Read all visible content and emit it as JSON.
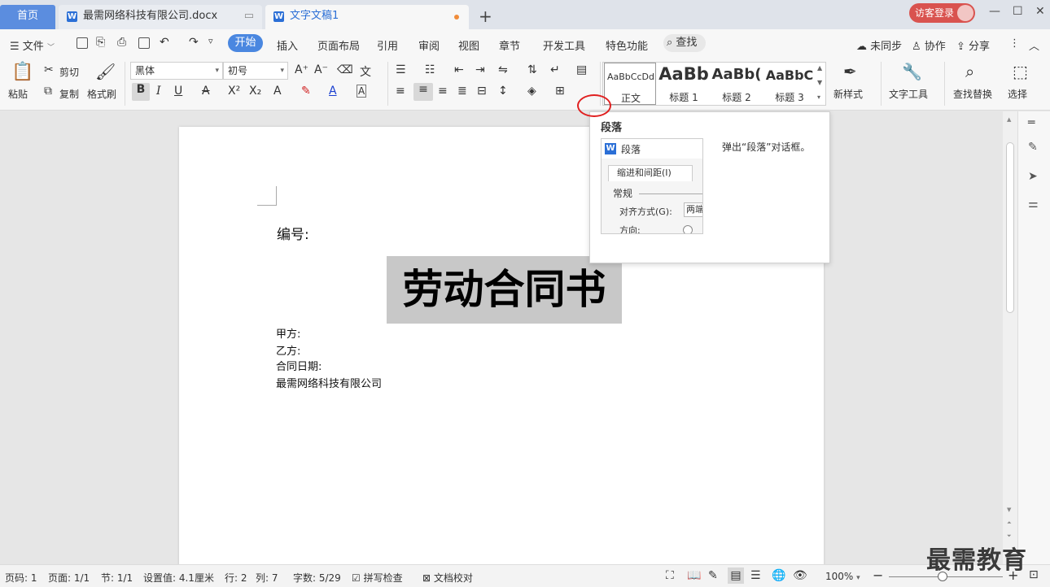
{
  "tabs": {
    "home": "首页",
    "doc1": "最需网络科技有限公司.docx",
    "doc2": "文字文稿1",
    "new_tab": "+"
  },
  "account": {
    "login": "访客登录"
  },
  "window": {
    "minimize": "—",
    "maximize": "☐",
    "close": "✕"
  },
  "menu": {
    "file": "文件",
    "start": "开始",
    "insert": "插入",
    "layout": "页面布局",
    "references": "引用",
    "review": "审阅",
    "view": "视图",
    "chapter": "章节",
    "developer": "开发工具",
    "special": "特色功能",
    "search": "查找",
    "sync": "未同步",
    "collab": "协作",
    "share": "分享"
  },
  "ribbon": {
    "paste": "粘贴",
    "cut": "剪切",
    "copy": "复制",
    "format_painter": "格式刷",
    "font_name": "黑体",
    "font_size": "初号",
    "styles": [
      {
        "preview": "AaBbCcDd",
        "name": "正文"
      },
      {
        "preview": "AaBb",
        "name": "标题 1"
      },
      {
        "preview": "AaBb(",
        "name": "标题 2"
      },
      {
        "preview": "AaBbC",
        "name": "标题 3"
      }
    ],
    "new_style": "新样式",
    "text_tools": "文字工具",
    "find_replace": "查找替换",
    "select": "选择"
  },
  "document": {
    "number_label": "编号:",
    "title": "劳动合同书",
    "party_a": "甲方:",
    "party_b": "乙方:",
    "contract_date": "合同日期:",
    "company": "最需网络科技有限公司"
  },
  "popup": {
    "title": "段落",
    "preview_title": "段落",
    "preview_tab": "缩进和间距(I)",
    "preview_section": "常规",
    "preview_align_label": "对齐方式(G):",
    "preview_align_value": "两端",
    "preview_direction_label": "方向:",
    "description": "弹出“段落”对话框。"
  },
  "status": {
    "page_num": "页码: 1",
    "pages": "页面: 1/1",
    "section": "节: 1/1",
    "setting": "设置值: 4.1厘米",
    "row": "行: 2",
    "col": "列: 7",
    "word_count": "字数: 5/29",
    "spell_check": "拼写检查",
    "doc_proof": "文档校对",
    "zoom": "100%"
  },
  "watermark": "最需教育"
}
